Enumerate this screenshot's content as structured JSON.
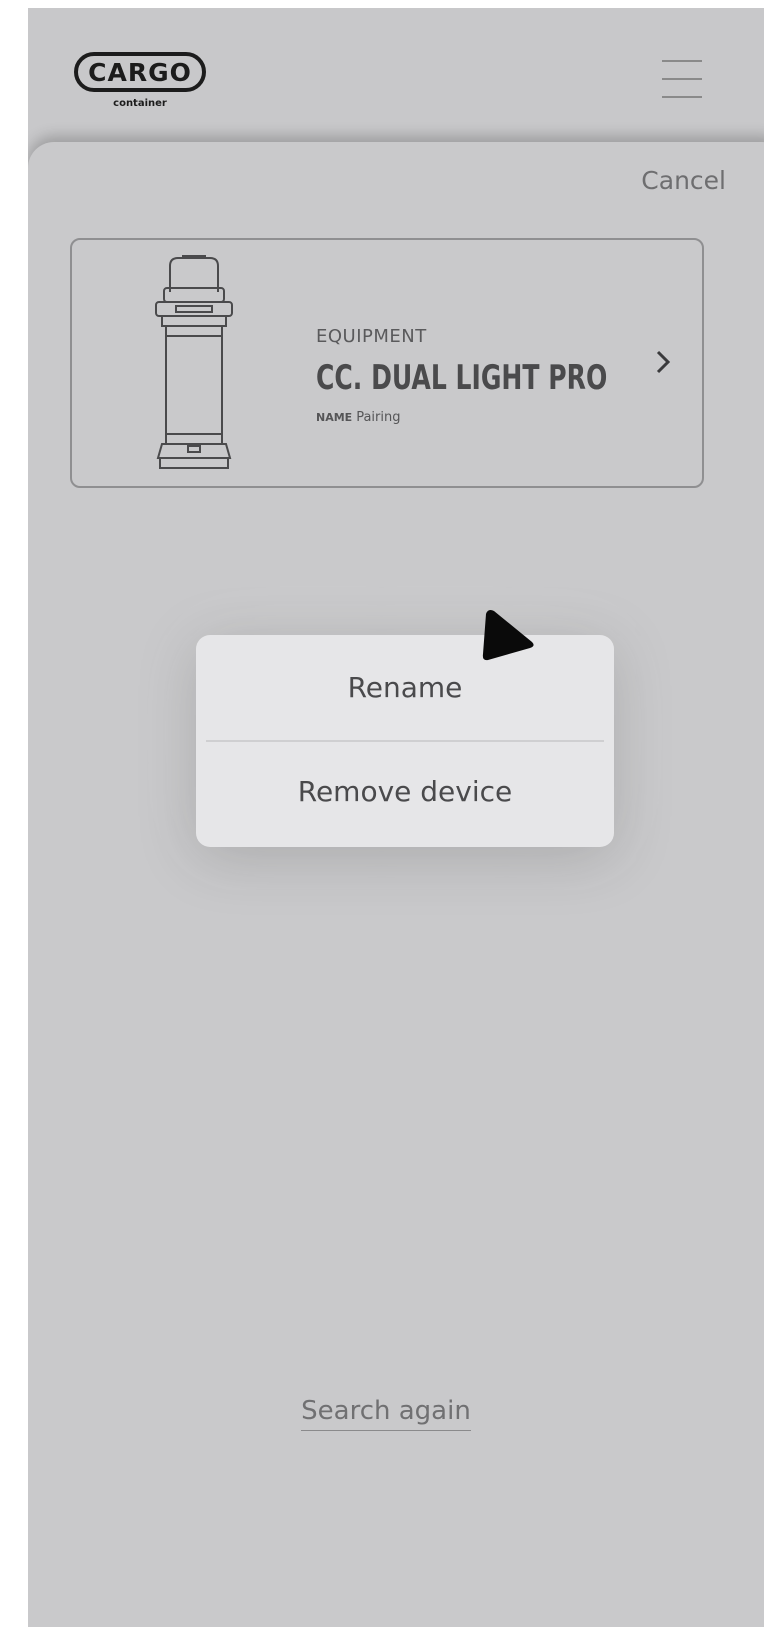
{
  "header": {
    "logo_text": "CARGO",
    "logo_subtext": "container",
    "menu_icon": "hamburger-menu-icon"
  },
  "sheet": {
    "cancel_label": "Cancel"
  },
  "device_card": {
    "category_label": "EQUIPMENT",
    "device_name": "CC. DUAL LIGHT PRO",
    "name_key": "NAME",
    "name_value": "Pairing",
    "image_icon": "lantern-device-icon",
    "chevron_icon": "chevron-right-icon"
  },
  "context_menu": {
    "items": [
      {
        "label": "Rename"
      },
      {
        "label": "Remove device"
      }
    ]
  },
  "footer": {
    "search_again_label": "Search again"
  },
  "colors": {
    "background": "#c9c9cb",
    "popup_background": "#e6e6e8",
    "text_dark": "#4a4a4c",
    "text_muted": "#6e6e70"
  }
}
